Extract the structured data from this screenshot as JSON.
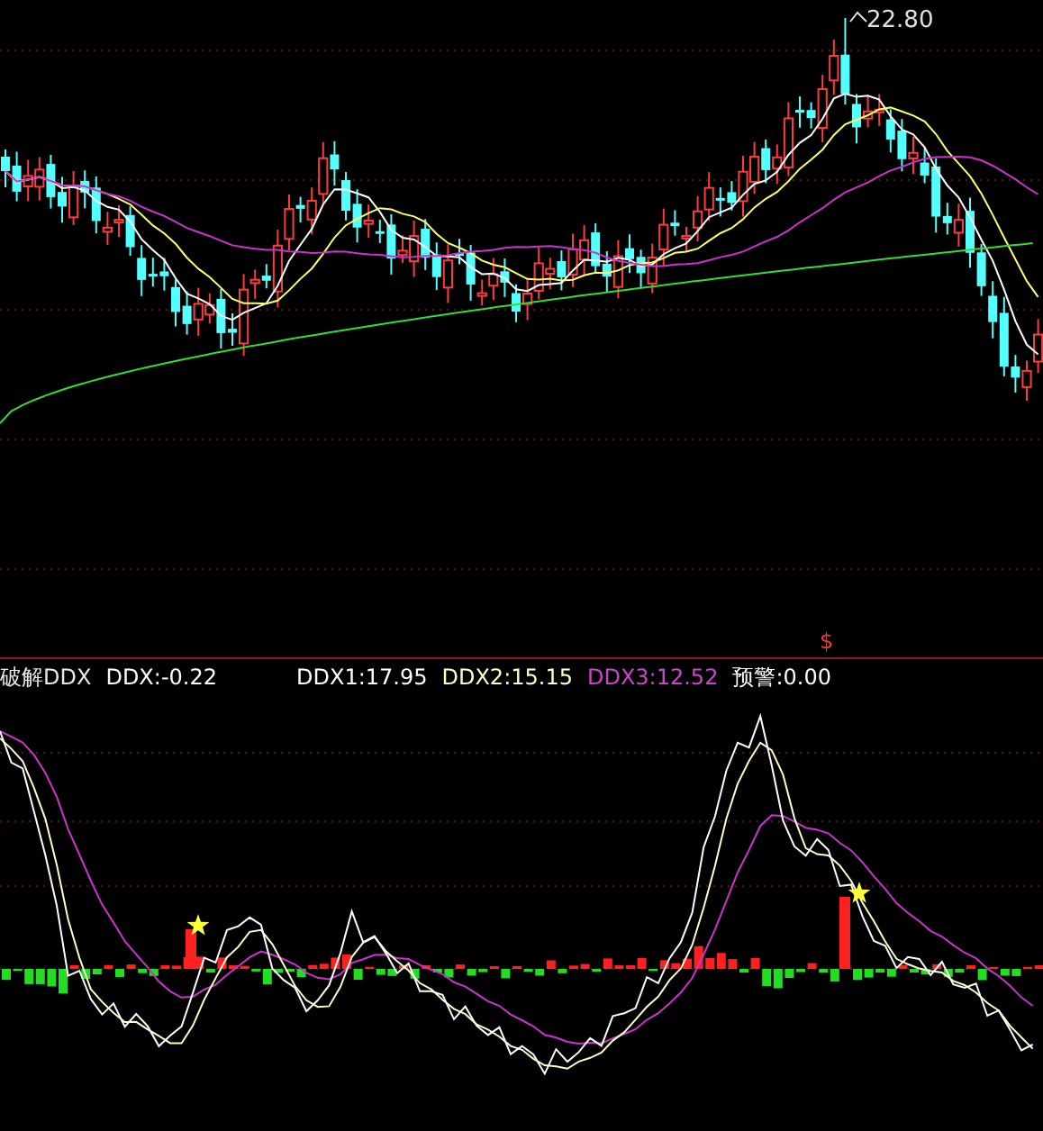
{
  "price_panel": {
    "high_label": "22.80",
    "signal_mark": "$"
  },
  "indicator_panel": {
    "legend_left": [
      {
        "text": "破解DDX",
        "color": "#e8e8e8"
      },
      {
        "text": "DDX:-0.22",
        "color": "#ffffff"
      }
    ],
    "legend_right": [
      {
        "text": "DDX1:17.95",
        "color": "#ffffff"
      },
      {
        "text": "DDX2:15.15",
        "color": "#ffffcc"
      },
      {
        "text": "DDX3:12.52",
        "color": "#cc44cc"
      },
      {
        "text": "预警:0.00",
        "color": "#ffffff"
      }
    ]
  }
}
